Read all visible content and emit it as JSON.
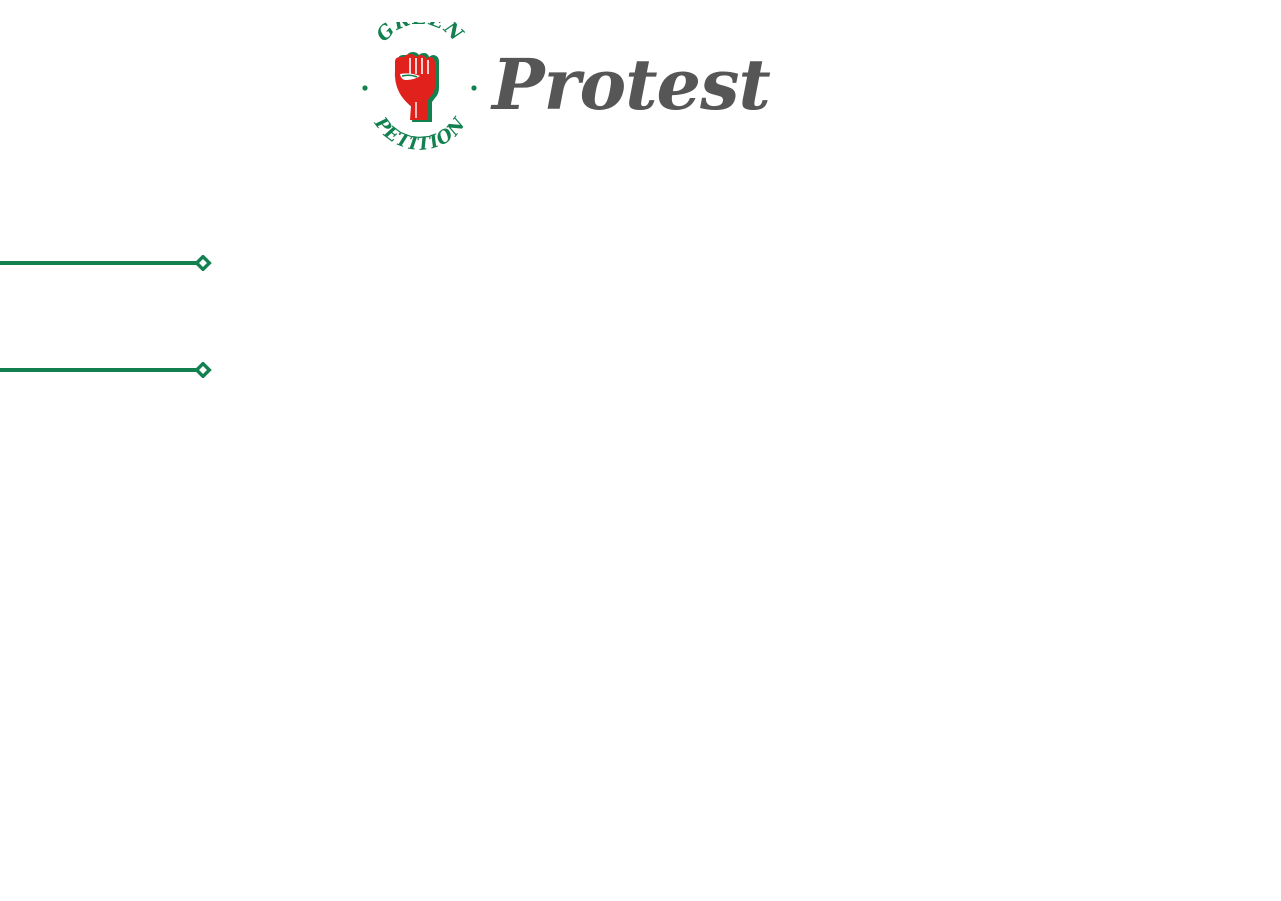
{
  "brand": {
    "logo": {
      "top_text": "GREEN",
      "bottom_text": "PETITION",
      "icon": "raised-fist-icon",
      "colors": {
        "green": "#138050",
        "red": "#e0211c"
      }
    },
    "wordmark": "Protest",
    "wordmark_color": "#565656"
  },
  "dividers": {
    "color": "#138050",
    "count": 2
  }
}
